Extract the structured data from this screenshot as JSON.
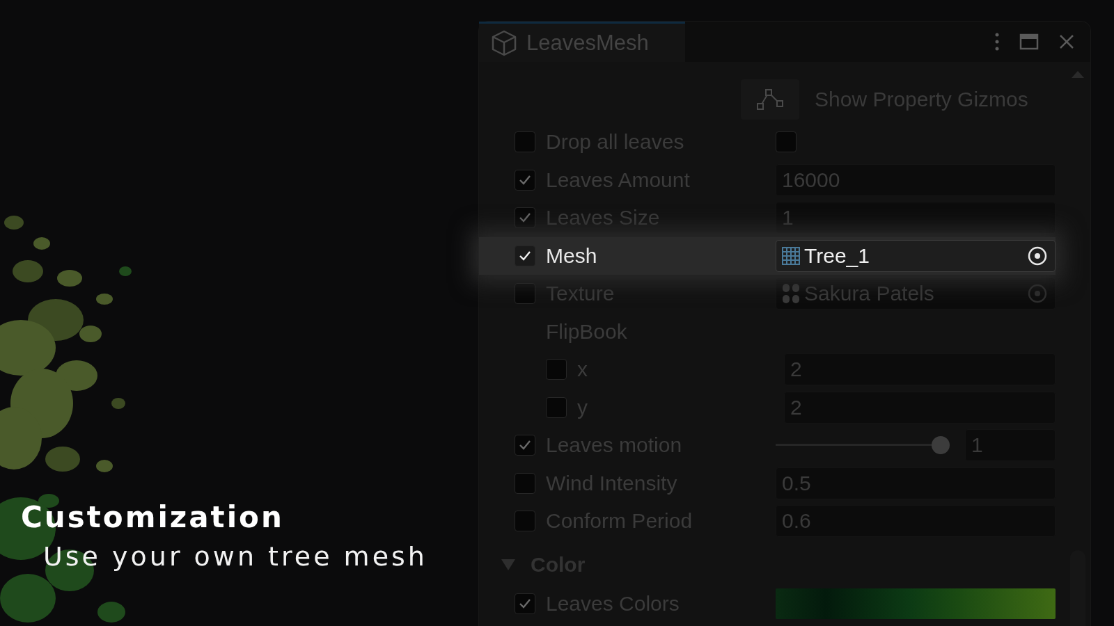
{
  "caption": {
    "title": "Customization",
    "subtitle": "Use your own tree mesh"
  },
  "inspector": {
    "tab": {
      "title": "LeavesMesh",
      "selected": true
    },
    "gizmo_button": {
      "label": "Show Property Gizmos"
    },
    "rows": [
      {
        "kind": "toggle",
        "label": "Drop all leaves",
        "checked": false,
        "value_checked": false,
        "highlighted": false
      },
      {
        "kind": "number",
        "label": "Leaves Amount",
        "checked": true,
        "value": "16000",
        "highlighted": false
      },
      {
        "kind": "number",
        "label": "Leaves Size",
        "checked": true,
        "value": "1",
        "highlighted": false
      },
      {
        "kind": "mesh_object",
        "label": "Mesh",
        "checked": true,
        "value": "Tree_1",
        "highlighted": true
      },
      {
        "kind": "texture_object",
        "label": "Texture",
        "checked": false,
        "value": "Sakura Patels",
        "highlighted": false
      },
      {
        "kind": "group",
        "label": "FlipBook",
        "highlighted": false
      },
      {
        "kind": "sub_number",
        "label": "x",
        "checked": false,
        "value": "2",
        "highlighted": false
      },
      {
        "kind": "sub_number",
        "label": "y",
        "checked": false,
        "value": "2",
        "highlighted": false
      },
      {
        "kind": "slider",
        "label": "Leaves motion",
        "checked": true,
        "level": 1,
        "value": "1",
        "highlighted": false
      },
      {
        "kind": "number",
        "label": "Wind Intensity",
        "checked": false,
        "value": "0.5",
        "highlighted": false
      },
      {
        "kind": "number",
        "label": "Conform Period",
        "checked": false,
        "value": "0.6",
        "highlighted": false
      },
      {
        "kind": "section",
        "label": "Color",
        "expanded": true,
        "highlighted": false
      },
      {
        "kind": "gradient",
        "label": "Leaves Colors",
        "checked": true,
        "highlighted": false
      }
    ]
  }
}
